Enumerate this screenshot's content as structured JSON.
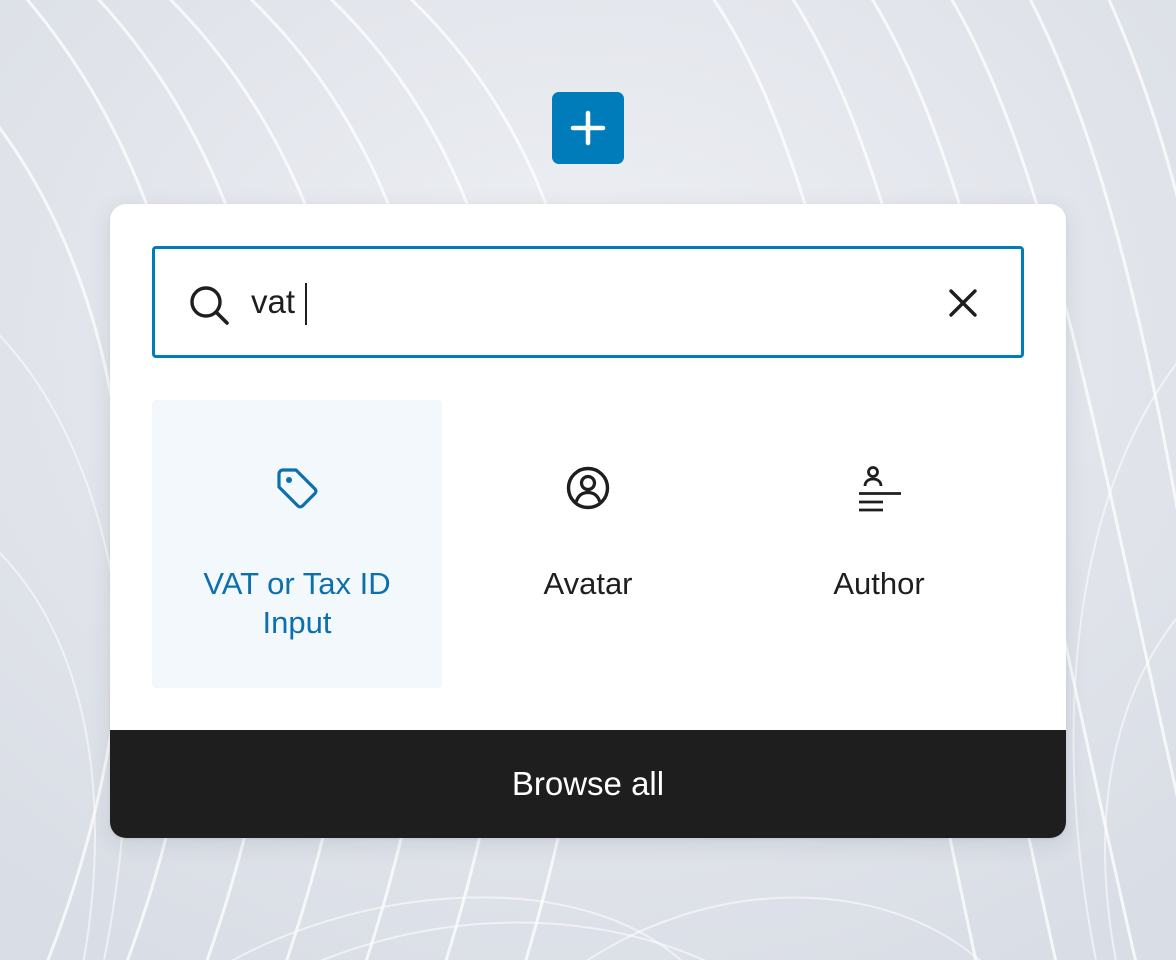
{
  "theme": {
    "accent": "#007cba",
    "accent_text": "#0c6fae",
    "selected_bg": "#f3f8fc",
    "dark": "#1e1e1e",
    "white": "#ffffff"
  },
  "add_button": {
    "icon": "plus-icon"
  },
  "search": {
    "icon": "search-icon",
    "value": "vat",
    "clear_icon": "close-icon"
  },
  "results": [
    {
      "label": "VAT or Tax ID Input",
      "icon": "tag-icon",
      "selected": true
    },
    {
      "label": "Avatar",
      "icon": "user-circle-icon",
      "selected": false
    },
    {
      "label": "Author",
      "icon": "author-icon",
      "selected": false
    }
  ],
  "footer": {
    "browse_all_label": "Browse all"
  }
}
